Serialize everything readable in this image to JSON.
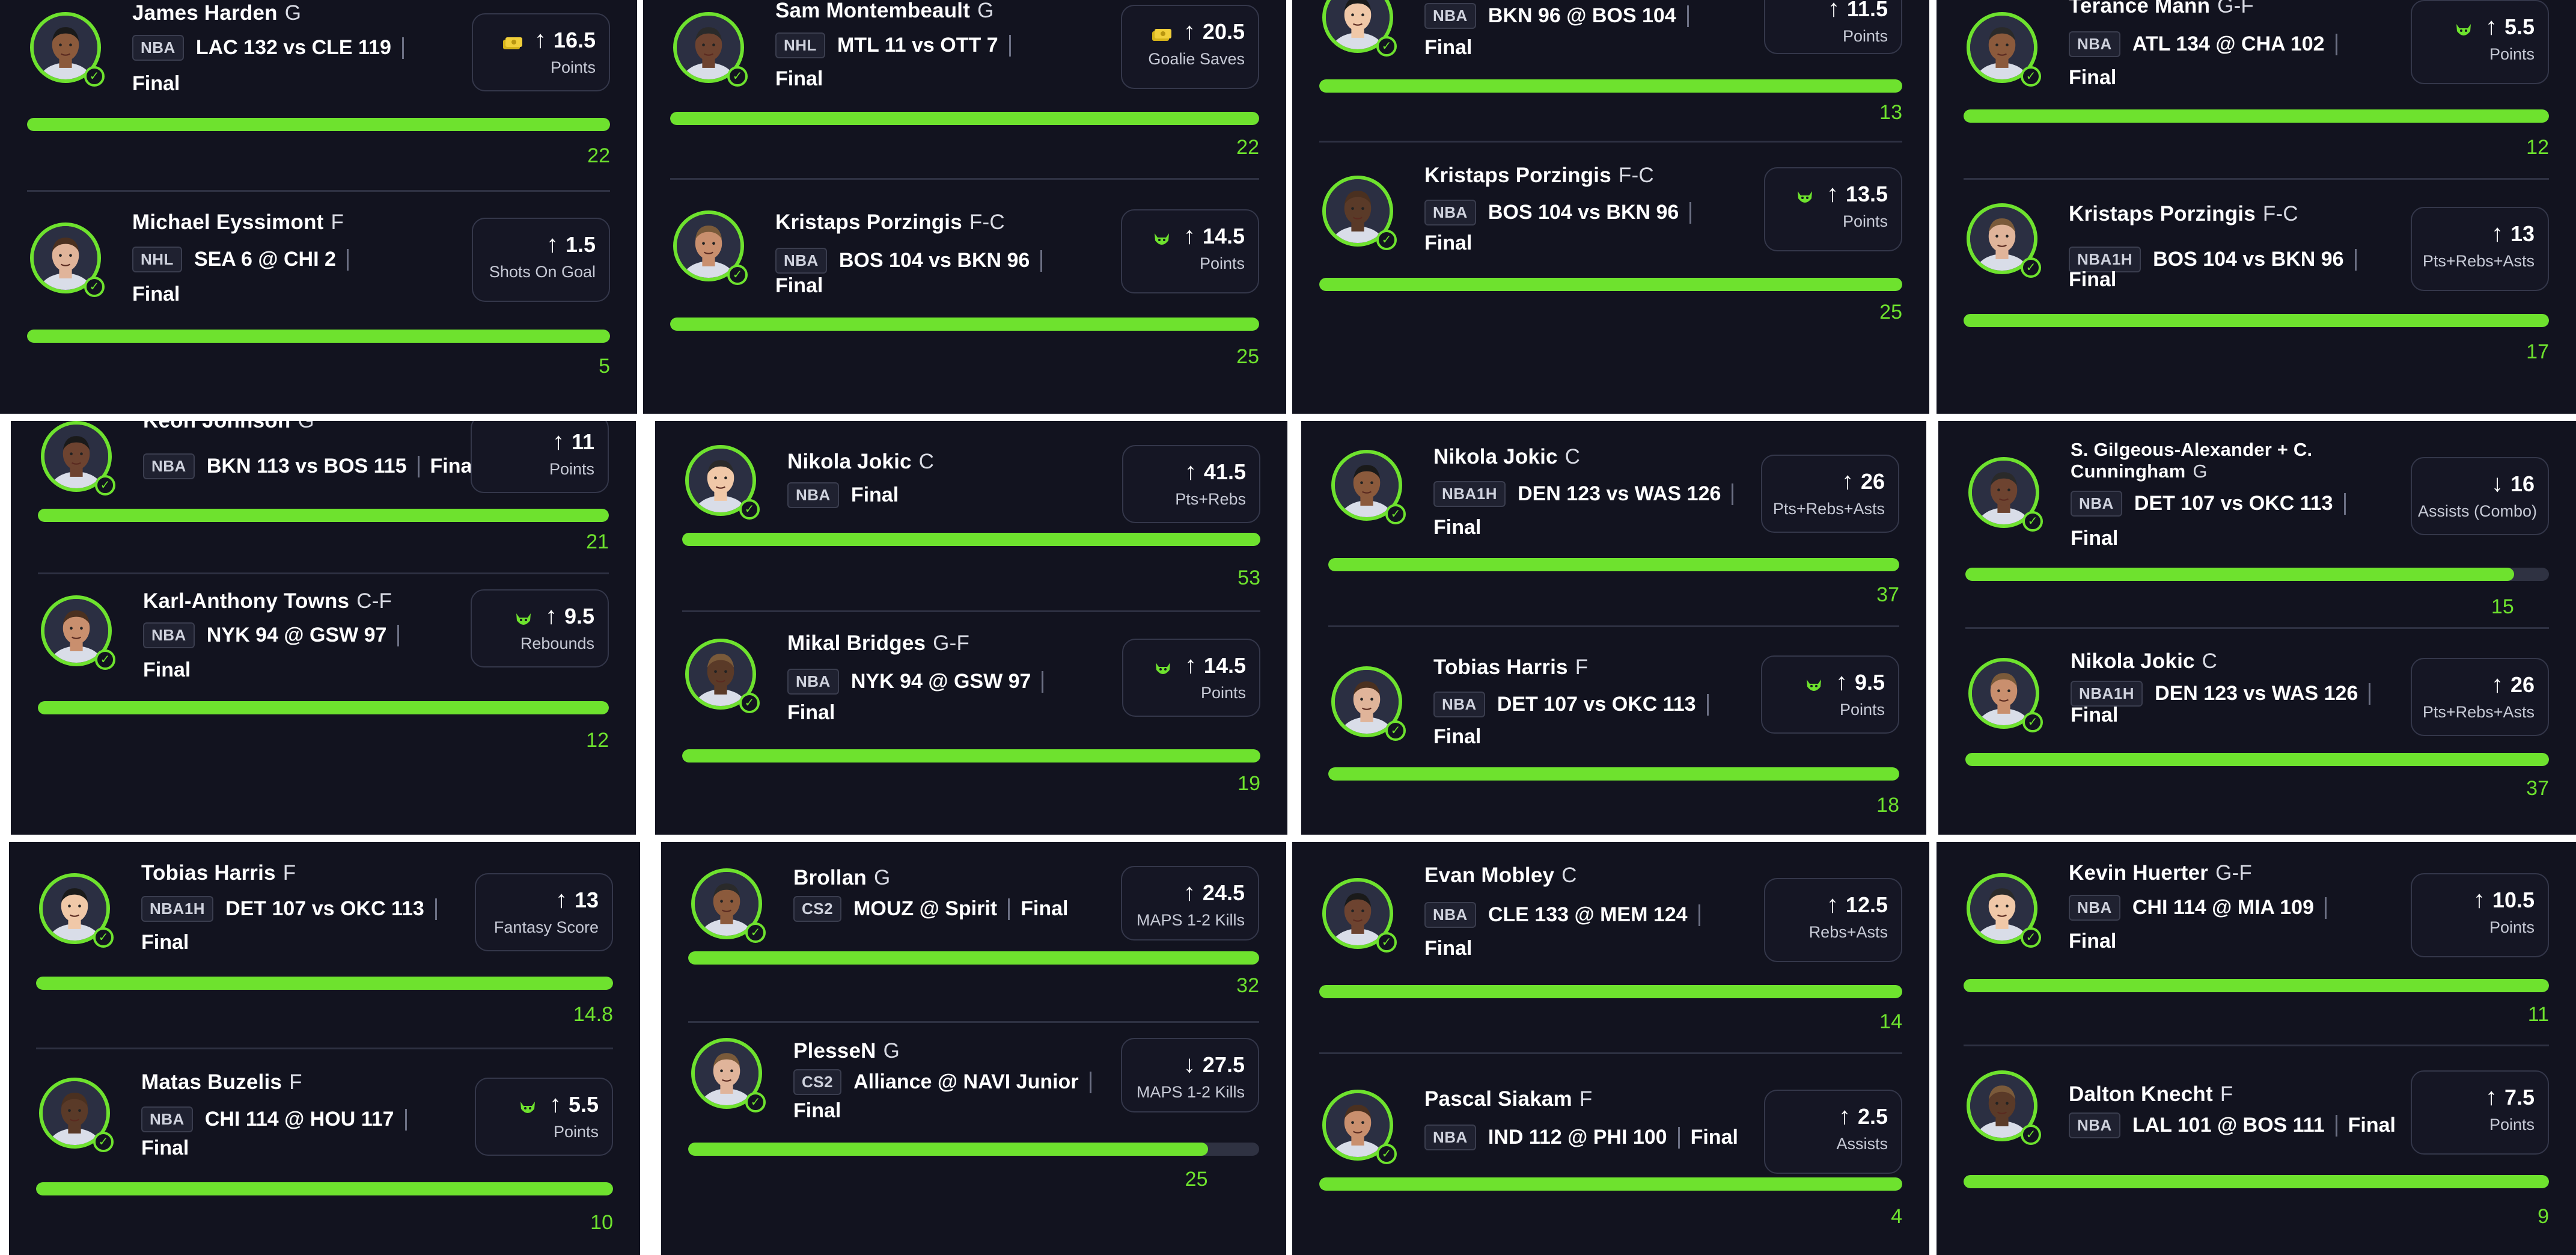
{
  "colors": {
    "accent": "#6ee22e",
    "background": "#12131f",
    "card_border": "#34374a",
    "text": "#ffffff",
    "muted": "#c7cad6"
  },
  "panels": [
    {
      "cards": [
        {
          "player": "James Harden",
          "pos": "G",
          "league": "NBA",
          "game": "LAC 132 vs CLE 119",
          "final": "Final",
          "icon": "money-icon",
          "direction": "up",
          "line": "16.5",
          "stat": "Points",
          "result": "22",
          "progress": 1
        },
        {
          "player": "Michael Eyssimont",
          "pos": "F",
          "league": "NHL",
          "game": "SEA 6 @ CHI 2",
          "final": "Final",
          "icon": "",
          "direction": "up",
          "line": "1.5",
          "stat": "Shots On Goal",
          "result": "5",
          "progress": 1
        }
      ]
    },
    {
      "cards": [
        {
          "player": "Sam Montembeault",
          "pos": "G",
          "league": "NHL",
          "game": "MTL 11 vs OTT 7",
          "final": "Final",
          "icon": "money-icon",
          "direction": "up",
          "line": "20.5",
          "stat": "Goalie Saves",
          "result": "22",
          "progress": 1
        },
        {
          "player": "Kristaps Porzingis",
          "pos": "F-C",
          "league": "NBA",
          "game": "BOS 104 vs BKN 96",
          "final": "Final",
          "icon": "demon-icon",
          "direction": "up",
          "line": "14.5",
          "stat": "Points",
          "result": "25",
          "progress": 1
        }
      ]
    },
    {
      "cards": [
        {
          "player": "",
          "pos": "",
          "league": "NBA",
          "game": "BKN 96 @ BOS 104",
          "final": "Final",
          "icon": "",
          "direction": "up",
          "line": "11.5",
          "stat": "Points",
          "result": "13",
          "progress": 1
        },
        {
          "player": "Kristaps Porzingis",
          "pos": "F-C",
          "league": "NBA",
          "game": "BOS 104 vs BKN 96",
          "final": "Final",
          "icon": "demon-icon",
          "direction": "up",
          "line": "13.5",
          "stat": "Points",
          "result": "25",
          "progress": 1
        }
      ]
    },
    {
      "cards": [
        {
          "player": "Terance Mann",
          "pos": "G-F",
          "league": "NBA",
          "game": "ATL 134 @ CHA 102",
          "final": "Final",
          "icon": "demon-icon",
          "direction": "up",
          "line": "5.5",
          "stat": "Points",
          "result": "12",
          "progress": 1
        },
        {
          "player": "Kristaps Porzingis",
          "pos": "F-C",
          "league": "NBA1H",
          "game": "BOS 104 vs BKN 96",
          "final": "Final",
          "icon": "",
          "direction": "up",
          "line": "13",
          "stat": "Pts+Rebs+Asts",
          "result": "17",
          "progress": 1
        }
      ]
    },
    {
      "cards": [
        {
          "player": "Keon Johnson",
          "pos": "G",
          "league": "NBA",
          "game": "BKN 113 vs BOS 115",
          "final": "Final",
          "icon": "",
          "direction": "up",
          "line": "11",
          "stat": "Points",
          "result": "21",
          "progress": 1
        },
        {
          "player": "Karl-Anthony Towns",
          "pos": "C-F",
          "league": "NBA",
          "game": "NYK 94 @ GSW 97",
          "final": "Final",
          "icon": "demon-icon",
          "direction": "up",
          "line": "9.5",
          "stat": "Rebounds",
          "result": "12",
          "progress": 1
        }
      ]
    },
    {
      "cards": [
        {
          "player": "Nikola Jokic",
          "pos": "C",
          "league": "NBA",
          "game": "",
          "final": "Final",
          "icon": "",
          "direction": "up",
          "line": "41.5",
          "stat": "Pts+Rebs",
          "result": "53",
          "progress": 1
        },
        {
          "player": "Mikal Bridges",
          "pos": "G-F",
          "league": "NBA",
          "game": "NYK 94 @ GSW 97",
          "final": "Final",
          "icon": "demon-icon",
          "direction": "up",
          "line": "14.5",
          "stat": "Points",
          "result": "19",
          "progress": 1
        }
      ]
    },
    {
      "cards": [
        {
          "player": "Nikola Jokic",
          "pos": "C",
          "league": "NBA1H",
          "game": "DEN 123 vs WAS 126",
          "final": "Final",
          "icon": "",
          "direction": "up",
          "line": "26",
          "stat": "Pts+Rebs+Asts",
          "result": "37",
          "progress": 1
        },
        {
          "player": "Tobias Harris",
          "pos": "F",
          "league": "NBA",
          "game": "DET 107 vs OKC 113",
          "final": "Final",
          "icon": "demon-icon",
          "direction": "up",
          "line": "9.5",
          "stat": "Points",
          "result": "18",
          "progress": 1
        }
      ]
    },
    {
      "cards": [
        {
          "player": "S. Gilgeous-Alexander + C. Cunningham",
          "pos": "G",
          "league": "NBA",
          "game": "DET 107 vs OKC 113",
          "final": "Final",
          "icon": "",
          "direction": "down",
          "line": "16",
          "stat": "Assists (Combo)",
          "result": "15",
          "progress": 0.94
        },
        {
          "player": "Nikola Jokic",
          "pos": "C",
          "league": "NBA1H",
          "game": "DEN 123 vs WAS 126",
          "final": "Final",
          "icon": "",
          "direction": "up",
          "line": "26",
          "stat": "Pts+Rebs+Asts",
          "result": "37",
          "progress": 1
        }
      ]
    },
    {
      "cards": [
        {
          "player": "Tobias Harris",
          "pos": "F",
          "league": "NBA1H",
          "game": "DET 107 vs OKC 113",
          "final": "Final",
          "icon": "",
          "direction": "up",
          "line": "13",
          "stat": "Fantasy Score",
          "result": "14.8",
          "progress": 1
        },
        {
          "player": "Matas Buzelis",
          "pos": "F",
          "league": "NBA",
          "game": "CHI 114 @ HOU 117",
          "final": "Final",
          "icon": "demon-icon",
          "direction": "up",
          "line": "5.5",
          "stat": "Points",
          "result": "10",
          "progress": 1
        }
      ]
    },
    {
      "cards": [
        {
          "player": "Brollan",
          "pos": "G",
          "league": "CS2",
          "game": "MOUZ @ Spirit",
          "final": "Final",
          "icon": "",
          "direction": "up",
          "line": "24.5",
          "stat": "MAPS 1-2 Kills",
          "result": "32",
          "progress": 1
        },
        {
          "player": "PlesseN",
          "pos": "G",
          "league": "CS2",
          "game": "Alliance @ NAVI Junior",
          "final": "Final",
          "icon": "",
          "direction": "down",
          "line": "27.5",
          "stat": "MAPS 1-2 Kills",
          "result": "25",
          "progress": 0.91
        }
      ]
    },
    {
      "cards": [
        {
          "player": "Evan Mobley",
          "pos": "C",
          "league": "NBA",
          "game": "CLE 133 @ MEM 124",
          "final": "Final",
          "icon": "",
          "direction": "up",
          "line": "12.5",
          "stat": "Rebs+Asts",
          "result": "14",
          "progress": 1
        },
        {
          "player": "Pascal Siakam",
          "pos": "F",
          "league": "NBA",
          "game": "IND 112 @ PHI 100",
          "final": "Final",
          "icon": "",
          "direction": "up",
          "line": "2.5",
          "stat": "Assists",
          "result": "4",
          "progress": 1
        }
      ]
    },
    {
      "cards": [
        {
          "player": "Kevin Huerter",
          "pos": "G-F",
          "league": "NBA",
          "game": "CHI 114 @ MIA 109",
          "final": "Final",
          "icon": "",
          "direction": "up",
          "line": "10.5",
          "stat": "Points",
          "result": "11",
          "progress": 1
        },
        {
          "player": "Dalton Knecht",
          "pos": "F",
          "league": "NBA",
          "game": "LAL 101 @ BOS 111",
          "final": "Final",
          "icon": "",
          "direction": "up",
          "line": "7.5",
          "stat": "Points",
          "result": "9",
          "progress": 1
        }
      ]
    }
  ]
}
